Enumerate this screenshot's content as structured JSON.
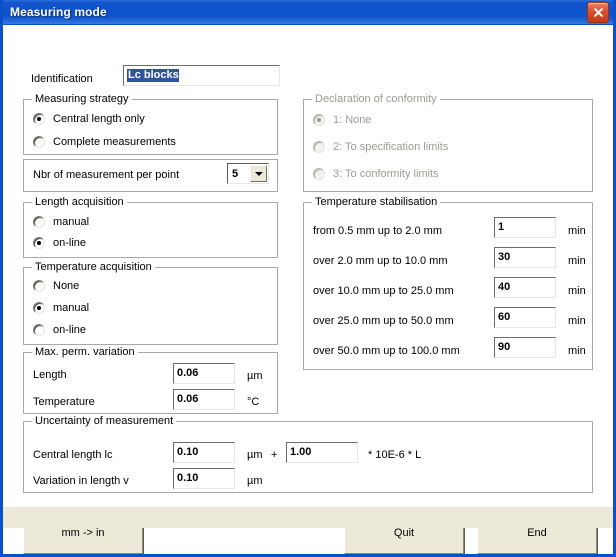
{
  "window": {
    "title": "Measuring mode",
    "close_icon": "close-icon"
  },
  "identification": {
    "label": "Identification",
    "value": "Lc blocks",
    "selected": true
  },
  "measuring_strategy": {
    "title": "Measuring strategy",
    "options": [
      {
        "label": "Central length only",
        "checked": true
      },
      {
        "label": "Complete measurements",
        "checked": false
      }
    ]
  },
  "nbr_measurement": {
    "label": "Nbr of measurement per point",
    "value": "5",
    "dropdown_icon": "chevron-down-icon"
  },
  "declaration_of_conformity": {
    "title": "Declaration of conformity",
    "disabled": true,
    "options": [
      {
        "label": "1: None",
        "checked": true
      },
      {
        "label": "2: To specification limits",
        "checked": false
      },
      {
        "label": "3: To conformity limits",
        "checked": false
      }
    ]
  },
  "length_acquisition": {
    "title": "Length acquisition",
    "options": [
      {
        "label": "manual",
        "checked": false
      },
      {
        "label": "on-line",
        "checked": true
      }
    ]
  },
  "temperature_acquisition": {
    "title": "Temperature acquisition",
    "options": [
      {
        "label": "None",
        "checked": false
      },
      {
        "label": "manual",
        "checked": true
      },
      {
        "label": "on-line",
        "checked": false
      }
    ]
  },
  "temperature_stabilisation": {
    "title": "Temperature stabilisation",
    "unit": "min",
    "rows": [
      {
        "label": "from 0.5 mm up to 2.0 mm",
        "value": "1",
        "unit": "min"
      },
      {
        "label": "over 2.0 mm up to 10.0 mm",
        "value": "30",
        "unit": "min"
      },
      {
        "label": "over 10.0 mm up to 25.0 mm",
        "value": "40",
        "unit": "min"
      },
      {
        "label": "over 25.0 mm up to 50.0 mm",
        "value": "60",
        "unit": "min"
      },
      {
        "label": "over 50.0 mm up to 100.0 mm",
        "value": "90",
        "unit": "min"
      }
    ]
  },
  "max_perm_variation": {
    "title": "Max. perm. variation",
    "rows": [
      {
        "label": "Length",
        "value": "0.06",
        "unit": "µm"
      },
      {
        "label": "Temperature",
        "value": "0.06",
        "unit": "°C"
      }
    ]
  },
  "uncertainty": {
    "title": "Uncertainty of measurement",
    "central_length": {
      "label": "Central length lc",
      "value": "0.10",
      "unit": "µm",
      "plus": "+",
      "coefficient": "1.00",
      "coefficient_unit": "* 10E-6 * L"
    },
    "variation": {
      "label": "Variation in length v",
      "value": "0.10",
      "unit": "µm"
    }
  },
  "buttons": {
    "convert": "mm -> in",
    "quit": "Quit",
    "end": "End"
  }
}
